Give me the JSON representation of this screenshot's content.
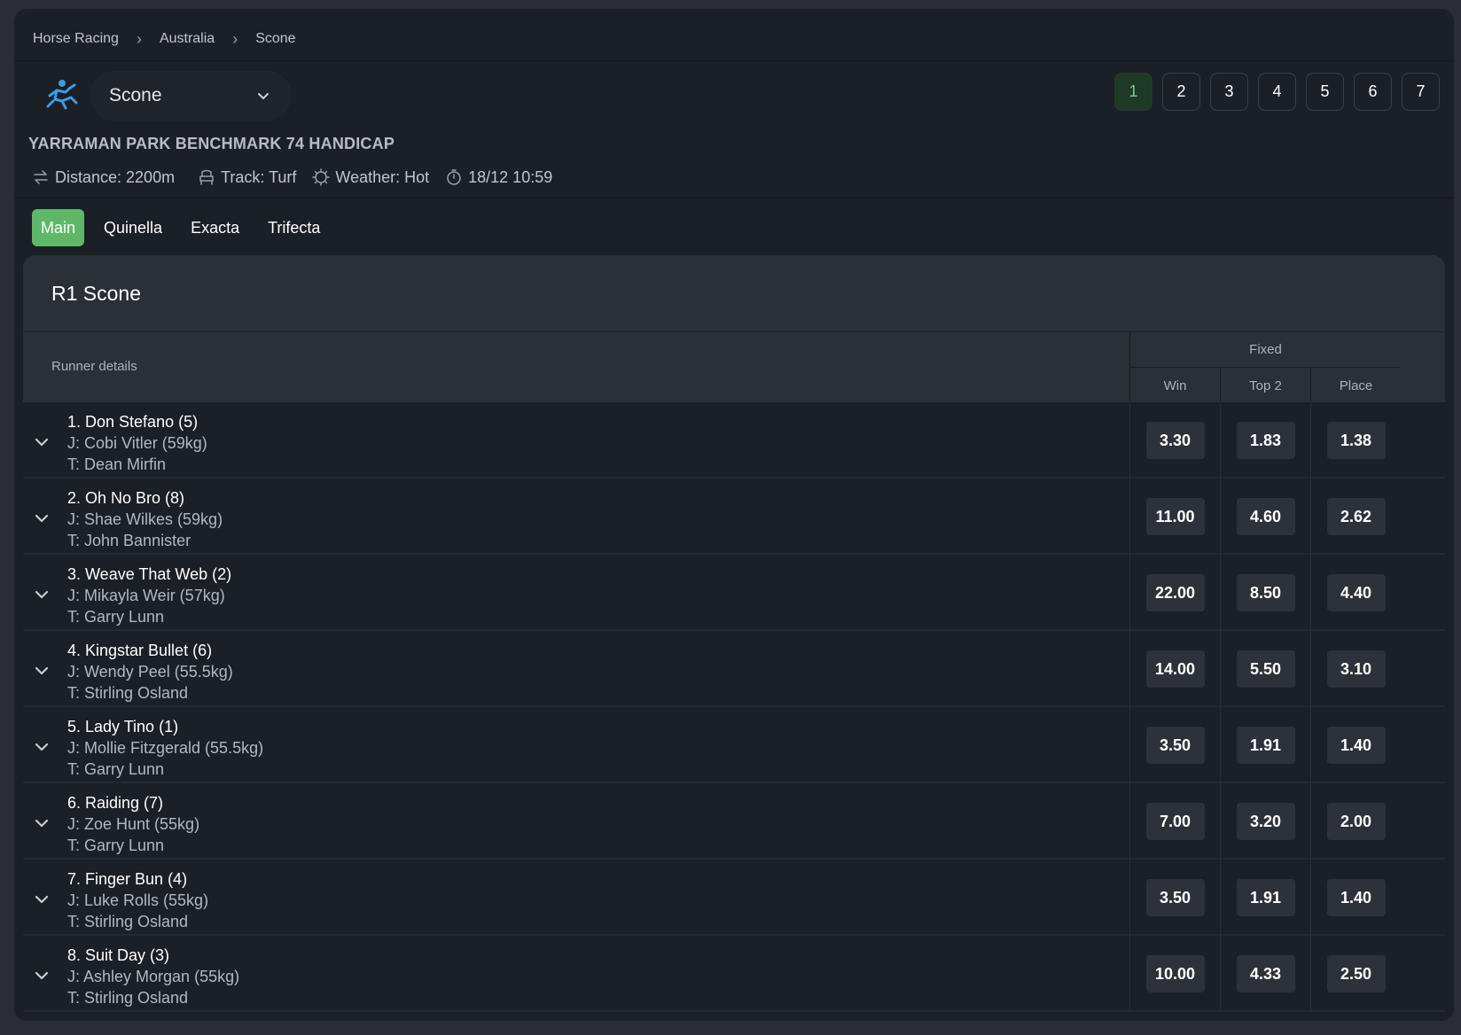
{
  "breadcrumb": [
    "Horse Racing",
    "Australia",
    "Scone"
  ],
  "breadcrumb_sep": "›",
  "venue": {
    "selected": "Scone"
  },
  "race_tabs": [
    "1",
    "2",
    "3",
    "4",
    "5",
    "6",
    "7"
  ],
  "race_active": "1",
  "race": {
    "name": "YARRAMAN PARK BENCHMARK 74 HANDICAP",
    "distance": "Distance: 2200m",
    "track": "Track: Turf",
    "weather": "Weather: Hot",
    "time": "18/12 10:59"
  },
  "bet_tabs": [
    "Main",
    "Quinella",
    "Exacta",
    "Trifecta"
  ],
  "bet_active": "Main",
  "card_title": "R1 Scone",
  "table": {
    "runner_details": "Runner details",
    "fixed": "Fixed",
    "columns": [
      "Win",
      "Top 2",
      "Place"
    ]
  },
  "runners": [
    {
      "name": "1. Don Stefano (5)",
      "jockey": "J: Cobi Vitler (59kg)",
      "trainer": "T: Dean Mirfin",
      "odds": [
        "3.30",
        "1.83",
        "1.38"
      ]
    },
    {
      "name": "2. Oh No Bro (8)",
      "jockey": "J: Shae Wilkes (59kg)",
      "trainer": "T: John Bannister",
      "odds": [
        "11.00",
        "4.60",
        "2.62"
      ]
    },
    {
      "name": "3. Weave That Web (2)",
      "jockey": "J: Mikayla Weir (57kg)",
      "trainer": "T: Garry Lunn",
      "odds": [
        "22.00",
        "8.50",
        "4.40"
      ]
    },
    {
      "name": "4. Kingstar Bullet (6)",
      "jockey": "J: Wendy Peel (55.5kg)",
      "trainer": "T: Stirling Osland",
      "odds": [
        "14.00",
        "5.50",
        "3.10"
      ]
    },
    {
      "name": "5. Lady Tino (1)",
      "jockey": "J: Mollie Fitzgerald (55.5kg)",
      "trainer": "T: Garry Lunn",
      "odds": [
        "3.50",
        "1.91",
        "1.40"
      ]
    },
    {
      "name": "6. Raiding (7)",
      "jockey": "J: Zoe Hunt (55kg)",
      "trainer": "T: Garry Lunn",
      "odds": [
        "7.00",
        "3.20",
        "2.00"
      ]
    },
    {
      "name": "7. Finger Bun (4)",
      "jockey": "J: Luke Rolls (55kg)",
      "trainer": "T: Stirling Osland",
      "odds": [
        "3.50",
        "1.91",
        "1.40"
      ]
    },
    {
      "name": "8. Suit Day (3)",
      "jockey": "J: Ashley Morgan (55kg)",
      "trainer": "T: Stirling Osland",
      "odds": [
        "10.00",
        "4.33",
        "2.50"
      ]
    }
  ],
  "colors": {
    "accent": "#5fb868",
    "active_race_bg": "#1e3a27",
    "active_race_text": "#7ec98d",
    "icon_blue": "#3b9ce6"
  },
  "icons": {
    "sport": "horse-racing-icon",
    "distance": "arrows-swap-icon",
    "track": "chair-icon",
    "weather": "sun-icon",
    "time": "stopwatch-icon",
    "expand": "chevron-down-icon"
  }
}
